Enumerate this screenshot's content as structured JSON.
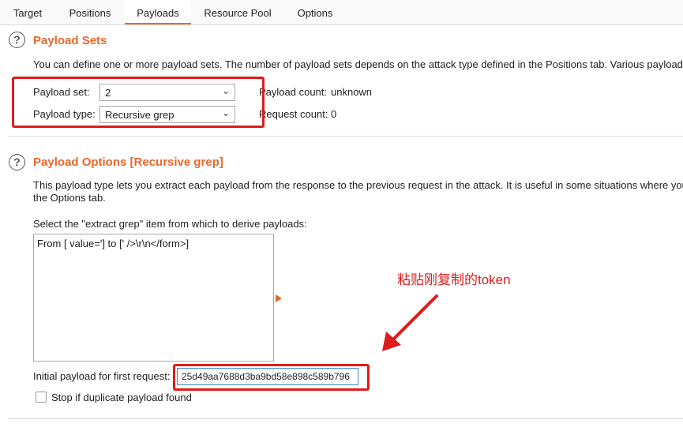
{
  "tabs": [
    "Target",
    "Positions",
    "Payloads",
    "Resource Pool",
    "Options"
  ],
  "active_tab": "Payloads",
  "payload_sets": {
    "title": "Payload Sets",
    "description": "You can define one or more payload sets. The number of payload sets depends on the attack type defined in the Positions tab. Various payload t",
    "set_label": "Payload set:",
    "set_value": "2",
    "type_label": "Payload type:",
    "type_value": "Recursive grep",
    "count_label": "Payload count:",
    "count_value": "unknown",
    "request_label": "Request count:",
    "request_value": "0"
  },
  "payload_options": {
    "title": "Payload Options [Recursive grep]",
    "desc_line1": "This payload type lets you extract each payload from the response to the previous request in the attack. It is useful in some situations where you",
    "desc_line2": "the Options tab.",
    "select_label": "Select the \"extract grep\" item from which to derive payloads:",
    "list_items": [
      "From [ value='] to [' />\\r\\n</form>]"
    ],
    "initial_label": "Initial payload for first request:",
    "initial_value": "25d49aa7688d3ba9bd58e898c589b796",
    "checkbox_label": "Stop if duplicate payload found"
  },
  "annotation": "粘贴刚复制的token",
  "colors": {
    "accent": "#e8682c",
    "annotation_red": "#e01b1b",
    "focus_blue": "#3c8ad8"
  },
  "icons": {
    "help": "question-circle-icon",
    "dropdown": "chevron-down-icon",
    "arrow": "red-arrow"
  }
}
